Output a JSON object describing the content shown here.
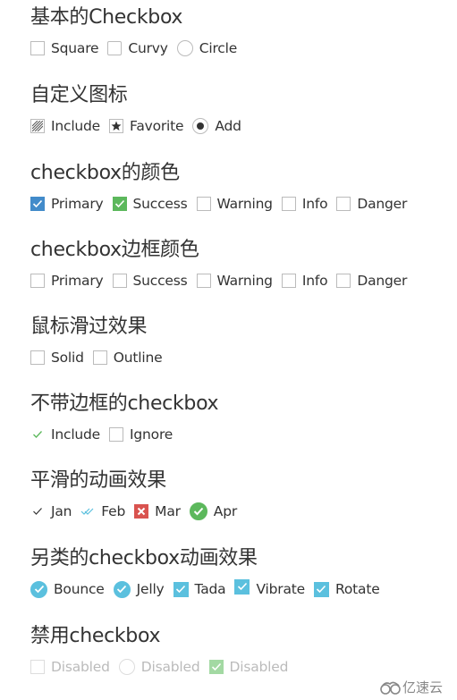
{
  "sections": [
    {
      "title": "基本的Checkbox",
      "items": [
        {
          "label": "Square",
          "icon": "square-box"
        },
        {
          "label": "Curvy",
          "icon": "curvy-box"
        },
        {
          "label": "Circle",
          "icon": "circle-box"
        }
      ]
    },
    {
      "title": "自定义图标",
      "items": [
        {
          "label": "Include",
          "icon": "hatched-icon"
        },
        {
          "label": "Favorite",
          "icon": "star-icon"
        },
        {
          "label": "Add",
          "icon": "radio-dot-icon"
        }
      ]
    },
    {
      "title": "checkbox的颜色",
      "items": [
        {
          "label": "Primary",
          "checked": true,
          "color": "#428bca"
        },
        {
          "label": "Success",
          "checked": true,
          "color": "#5cb85c"
        },
        {
          "label": "Warning",
          "checked": false
        },
        {
          "label": "Info",
          "checked": false
        },
        {
          "label": "Danger",
          "checked": false
        }
      ]
    },
    {
      "title": "checkbox边框颜色",
      "items": [
        {
          "label": "Primary"
        },
        {
          "label": "Success"
        },
        {
          "label": "Warning"
        },
        {
          "label": "Info"
        },
        {
          "label": "Danger"
        }
      ]
    },
    {
      "title": "鼠标滑过效果",
      "items": [
        {
          "label": "Solid"
        },
        {
          "label": "Outline"
        }
      ]
    },
    {
      "title": "不带边框的checkbox",
      "items": [
        {
          "label": "Include",
          "checked": true,
          "color": "#5cb85c"
        },
        {
          "label": "Ignore",
          "checked": false
        }
      ]
    },
    {
      "title": "平滑的动画效果",
      "items": [
        {
          "label": "Jan",
          "icon": "check-icon",
          "color": "#333333"
        },
        {
          "label": "Feb",
          "icon": "double-check-icon",
          "color": "#5bc0de"
        },
        {
          "label": "Mar",
          "icon": "cross-icon",
          "color": "#d9534f"
        },
        {
          "label": "Apr",
          "icon": "check-circle-icon",
          "color": "#5cb85c"
        }
      ]
    },
    {
      "title": "另类的checkbox动画效果",
      "items": [
        {
          "label": "Bounce",
          "icon": "round-check",
          "color": "#5bc0de"
        },
        {
          "label": "Jelly",
          "icon": "round-check",
          "color": "#5bc0de"
        },
        {
          "label": "Tada",
          "icon": "square-check",
          "color": "#5bc0de"
        },
        {
          "label": "Vibrate",
          "icon": "square-check",
          "color": "#5bc0de"
        },
        {
          "label": "Rotate",
          "icon": "square-check",
          "color": "#5bc0de"
        }
      ]
    },
    {
      "title": "禁用checkbox",
      "items": [
        {
          "label": "Disabled",
          "icon": "square-box"
        },
        {
          "label": "Disabled",
          "icon": "circle-box"
        },
        {
          "label": "Disabled",
          "icon": "square-check",
          "color": "#a3d9a3"
        }
      ]
    }
  ],
  "watermark": {
    "text": "亿速云"
  }
}
